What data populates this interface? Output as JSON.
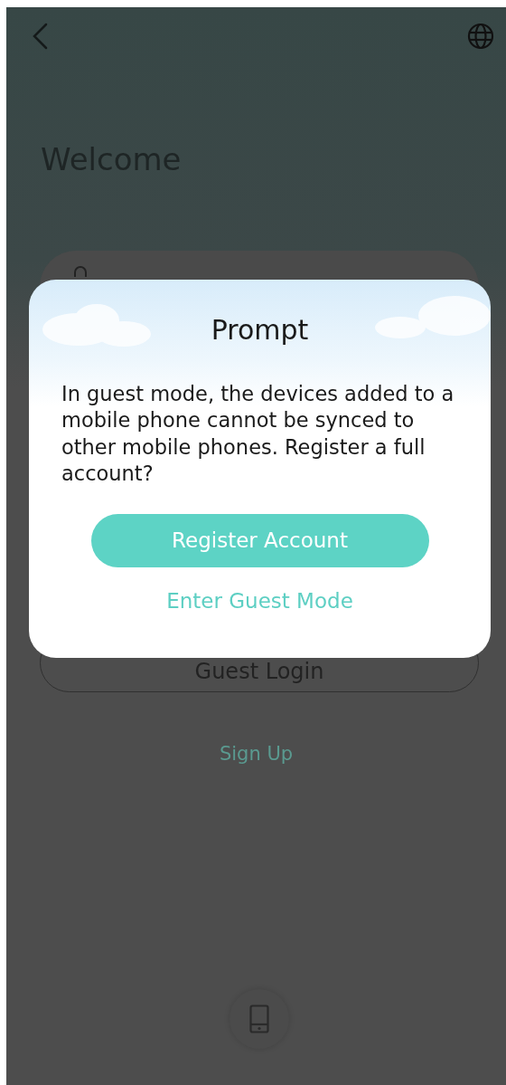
{
  "header": {
    "title": "Welcome"
  },
  "login": {
    "guest_button": "Guest Login",
    "sign_up": "Sign Up"
  },
  "dialog": {
    "title": "Prompt",
    "message": "In guest mode, the devices added to a mobile phone cannot be synced to other mobile phones. Register a full account?",
    "primary_button": "Register Account",
    "secondary_link": "Enter Guest Mode"
  }
}
